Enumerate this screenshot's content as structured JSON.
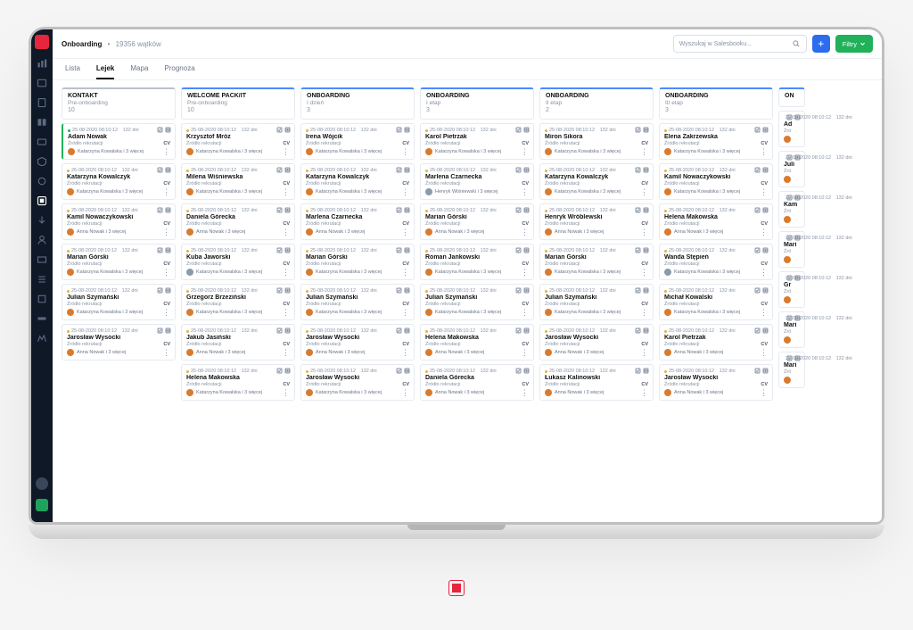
{
  "breadcrumb": {
    "title": "Onboarding",
    "sub": "19356 wątków"
  },
  "search": {
    "placeholder": "Wyszukaj w Salesbooku..."
  },
  "buttons": {
    "add": "+",
    "filter": "Filtry"
  },
  "tabs": [
    {
      "label": "Lista",
      "active": false
    },
    {
      "label": "Lejek",
      "active": true
    },
    {
      "label": "Mapa",
      "active": false
    },
    {
      "label": "Prognoza",
      "active": false
    }
  ],
  "meta_common": {
    "date": "25-08-2020 08:10:12",
    "days": "132 dni",
    "source": "Źródło rekrutacji",
    "cv": "CV"
  },
  "owners": {
    "kk": {
      "name": "Katarzyna Kowalska i 3 więcej",
      "color": "#d97b2e"
    },
    "an": {
      "name": "Anna Nowak i 3 więcej",
      "color": "#d97b2e"
    },
    "hw": {
      "name": "Henryk Wiśniewski i 3 więcej",
      "color": "#8a9aad"
    },
    "kk2": {
      "name": "Katarzyna Kowalska i 3 więcej",
      "color": "#8a9aad"
    }
  },
  "columns": [
    {
      "title": "KONTAKT",
      "sub": "Pre-onboarding",
      "count": "10",
      "accent": "grey",
      "cards": [
        {
          "name": "Adam Nowak",
          "owner": "kk",
          "dot": "#20b15a",
          "first": true
        },
        {
          "name": "Katarzyna Kowalczyk",
          "owner": "kk",
          "dot": "#e6b23a"
        },
        {
          "name": "Kamil Nowaczykowski",
          "owner": "an",
          "dot": "#e6b23a"
        },
        {
          "name": "Marian Górski",
          "owner": "kk",
          "dot": "#e6b23a"
        },
        {
          "name": "Julian Szymański",
          "owner": "kk",
          "dot": "#e6b23a"
        },
        {
          "name": "Jarosław Wysocki",
          "owner": "an",
          "dot": "#e6b23a"
        }
      ]
    },
    {
      "title": "WELCOME PACK/IT",
      "sub": "Pre-onboarding",
      "count": "10",
      "accent": "blue",
      "cards": [
        {
          "name": "Krzysztof Mróz",
          "owner": "kk",
          "dot": "#e6b23a"
        },
        {
          "name": "Milena Wiśniewska",
          "owner": "kk",
          "dot": "#e6b23a"
        },
        {
          "name": "Daniela Górecka",
          "owner": "an",
          "dot": "#e6b23a"
        },
        {
          "name": "Kuba Jaworski",
          "owner": "kk2",
          "dot": "#e6b23a"
        },
        {
          "name": "Grzegorz Brzeziński",
          "owner": "kk",
          "dot": "#e6b23a"
        },
        {
          "name": "Jakub Jasiński",
          "owner": "an",
          "dot": "#e6b23a"
        },
        {
          "name": "Helena Makowska",
          "owner": "kk",
          "dot": "#e6b23a"
        }
      ]
    },
    {
      "title": "ONBOARDING",
      "sub": "I dzień",
      "count": "3",
      "accent": "blue",
      "cards": [
        {
          "name": "Irena Wójcik",
          "owner": "kk",
          "dot": "#e6b23a"
        },
        {
          "name": "Katarzyna Kowalczyk",
          "owner": "kk",
          "dot": "#e6b23a"
        },
        {
          "name": "Marlena Czarnecka",
          "owner": "an",
          "dot": "#e6b23a"
        },
        {
          "name": "Marian Górski",
          "owner": "kk",
          "dot": "#e6b23a"
        },
        {
          "name": "Julian Szymański",
          "owner": "kk",
          "dot": "#e6b23a"
        },
        {
          "name": "Jarosław Wysocki",
          "owner": "an",
          "dot": "#e6b23a"
        },
        {
          "name": "Jarosław Wysocki",
          "owner": "kk",
          "dot": "#e6b23a"
        }
      ]
    },
    {
      "title": "ONBOARDING",
      "sub": "I etap",
      "count": "3",
      "accent": "blue",
      "cards": [
        {
          "name": "Karol Pietrzak",
          "owner": "kk",
          "dot": "#e6b23a"
        },
        {
          "name": "Marlena Czarnecka",
          "owner": "hw",
          "dot": "#e6b23a"
        },
        {
          "name": "Marian Górski",
          "owner": "an",
          "dot": "#e6b23a"
        },
        {
          "name": "Roman Jankowski",
          "owner": "kk",
          "dot": "#e6b23a"
        },
        {
          "name": "Julian Szymański",
          "owner": "kk",
          "dot": "#e6b23a"
        },
        {
          "name": "Helena Makowska",
          "owner": "an",
          "dot": "#e6b23a"
        },
        {
          "name": "Daniela Górecka",
          "owner": "an",
          "dot": "#e6b23a"
        }
      ]
    },
    {
      "title": "ONBOARDING",
      "sub": "II etap",
      "count": "2",
      "accent": "blue",
      "cards": [
        {
          "name": "Miron Sikora",
          "owner": "kk",
          "dot": "#e6b23a"
        },
        {
          "name": "Katarzyna Kowalczyk",
          "owner": "kk",
          "dot": "#e6b23a"
        },
        {
          "name": "Henryk Wróblewski",
          "owner": "an",
          "dot": "#e6b23a"
        },
        {
          "name": "Marian Górski",
          "owner": "kk",
          "dot": "#e6b23a"
        },
        {
          "name": "Julian Szymański",
          "owner": "kk",
          "dot": "#e6b23a"
        },
        {
          "name": "Jarosław Wysocki",
          "owner": "an",
          "dot": "#e6b23a"
        },
        {
          "name": "Łukasz Kalinowski",
          "owner": "an",
          "dot": "#e6b23a"
        }
      ]
    },
    {
      "title": "ONBOARDING",
      "sub": "III etap",
      "count": "3",
      "accent": "blue",
      "cards": [
        {
          "name": "Elena Zakrzewska",
          "owner": "kk",
          "dot": "#e6b23a"
        },
        {
          "name": "Kamil Nowaczykowski",
          "owner": "kk",
          "dot": "#e6b23a"
        },
        {
          "name": "Helena Makowska",
          "owner": "an",
          "dot": "#e6b23a"
        },
        {
          "name": "Wanda Stępień",
          "owner": "kk2",
          "dot": "#e6b23a"
        },
        {
          "name": "Michał Kowalski",
          "owner": "kk",
          "dot": "#e6b23a"
        },
        {
          "name": "Karol Pietrzak",
          "owner": "an",
          "dot": "#e6b23a"
        },
        {
          "name": "Jarosław Wysocki",
          "owner": "an",
          "dot": "#e6b23a"
        }
      ]
    },
    {
      "title": "ON",
      "sub": "",
      "count": "",
      "accent": "blue",
      "partial": true,
      "cards": [
        {
          "name": "Ad",
          "owner": "kk",
          "dot": "#e6b23a"
        },
        {
          "name": "Juli",
          "owner": "kk",
          "dot": "#e6b23a"
        },
        {
          "name": "Kam",
          "owner": "an",
          "dot": "#e6b23a"
        },
        {
          "name": "Mari",
          "owner": "kk",
          "dot": "#e6b23a"
        },
        {
          "name": "Gr",
          "owner": "kk",
          "dot": "#e6b23a"
        },
        {
          "name": "Mari",
          "owner": "an",
          "dot": "#e6b23a"
        },
        {
          "name": "Mari",
          "owner": "an",
          "dot": "#e6b23a"
        }
      ]
    }
  ]
}
